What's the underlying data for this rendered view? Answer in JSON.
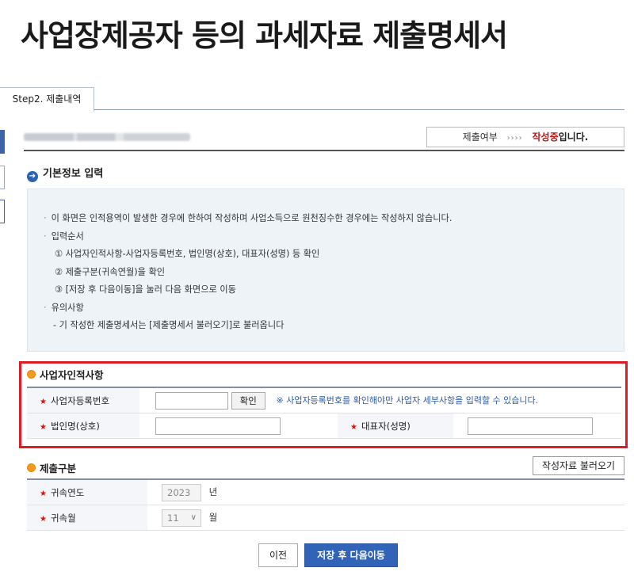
{
  "page_title": "사업장제공자 등의 과세자료 제출명세서",
  "tab": {
    "label": "Step2. 제출내역"
  },
  "status": {
    "label": "제출여부",
    "arrows": "››››",
    "state": "작성중",
    "suffix": "입니다."
  },
  "section_basic": {
    "title": "기본정보 입력",
    "icon": "arrow-right-circle-icon"
  },
  "guide": {
    "line1": "이 화면은 인적용역이 발생한 경우에 한하여 작성하며 사업소득으로 원천징수한 경우에는 작성하지 않습니다.",
    "line2": "입력순서",
    "step1": "① 사업자인적사항-사업자등록번호, 법인명(상호), 대표자(성명) 등 확인",
    "step2": "② 제출구분(귀속연월)을 확인",
    "step3": "③ [저장 후 다음이동]을 눌러 다음 화면으로 이동",
    "line3": "유의사항",
    "note1": "- 기 작성한 제출명세서는 [제출명세서 불러오기]로 불러옵니다"
  },
  "business_info": {
    "title": "사업자인적사항",
    "reg_no_label": "사업자등록번호",
    "reg_no_value": "",
    "confirm_button": "확인",
    "reg_note": "※ 사업자등록번호를 확인해야만 사업자 세부사항을 입력할 수 있습니다.",
    "corp_name_label": "법인명(상호)",
    "corp_name_value": "",
    "rep_label": "대표자(성명)",
    "rep_value": ""
  },
  "submission": {
    "title": "제출구분",
    "load_button": "작성자료 불러오기",
    "year_label": "귀속연도",
    "year_value": "2023",
    "year_unit": "년",
    "month_label": "귀속월",
    "month_value": "11",
    "month_unit": "월"
  },
  "buttons": {
    "prev": "이전",
    "save_next": "저장 후 다음이동"
  },
  "colors": {
    "required": "#dd1111",
    "accent": "#3163b6",
    "highlight": "#e01b24",
    "state": "#b21a1a"
  }
}
